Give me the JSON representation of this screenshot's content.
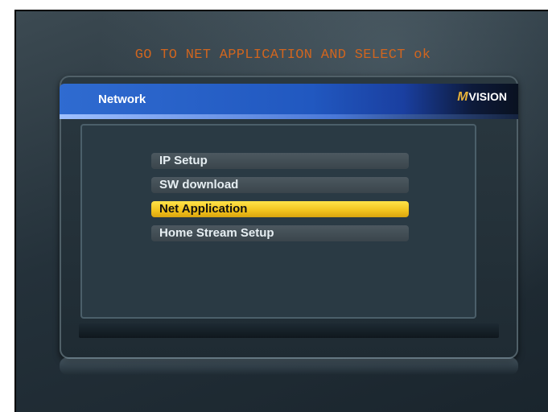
{
  "instruction": "GO TO NET APPLICATION AND SELECT ok",
  "panel": {
    "title": "Network",
    "logo": {
      "mark": "M",
      "text": "VISION"
    }
  },
  "menu": {
    "items": [
      "IP Setup",
      "SW download",
      "Net Application",
      "Home Stream Setup"
    ],
    "selected": "Net Application"
  },
  "colors": {
    "instruction": "#d0651f",
    "header": "#2f6bd0",
    "selected": "#f1c21c"
  }
}
